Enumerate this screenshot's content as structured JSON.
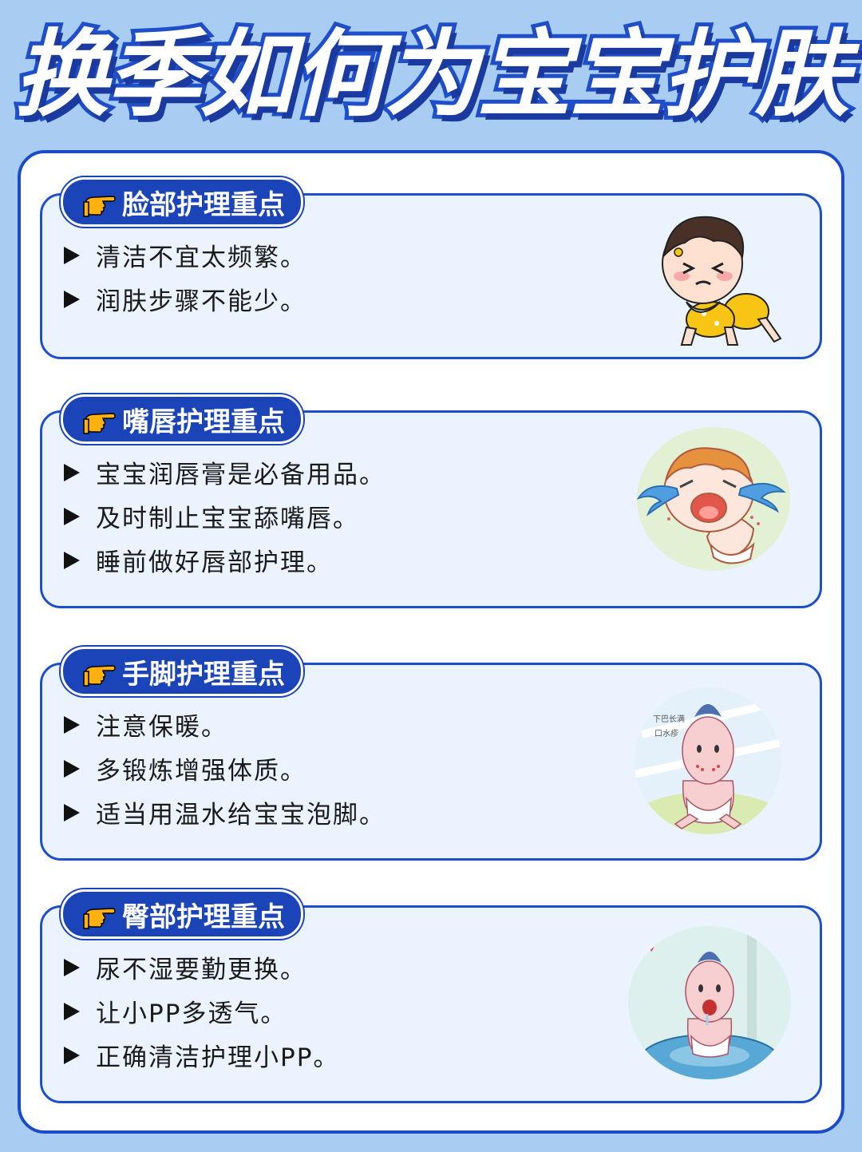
{
  "title": "换季如何为宝宝护肤",
  "sections": [
    {
      "heading": "脸部护理重点",
      "items": [
        "清洁不宜太频繁。",
        "润肤步骤不能少。"
      ],
      "illustration": "crawling-baby-crying"
    },
    {
      "heading": "嘴唇护理重点",
      "items": [
        "宝宝润唇膏是必备用品。",
        "及时制止宝宝舔嘴唇。",
        "睡前做好唇部护理。"
      ],
      "illustration": "crying-baby-circle"
    },
    {
      "heading": "手脚护理重点",
      "items": [
        "注意保暖。",
        "多锻炼增强体质。",
        "适当用温水给宝宝泡脚。"
      ],
      "illustration": "sitting-baby-rash",
      "illustration_text": [
        "下巴长满",
        "口水疹"
      ]
    },
    {
      "heading": "臀部护理重点",
      "items": [
        "尿不湿要勤更换。",
        "让小PP多透气。",
        "正确清洁护理小PP。"
      ],
      "illustration": "baby-on-cushion"
    }
  ],
  "colors": {
    "background": "#a9ccf2",
    "accent": "#1b44b8",
    "card": "#eaf3fe"
  },
  "icons": {
    "tab": "pointing-hand-icon",
    "bullet": "triangle-bullet-icon"
  }
}
